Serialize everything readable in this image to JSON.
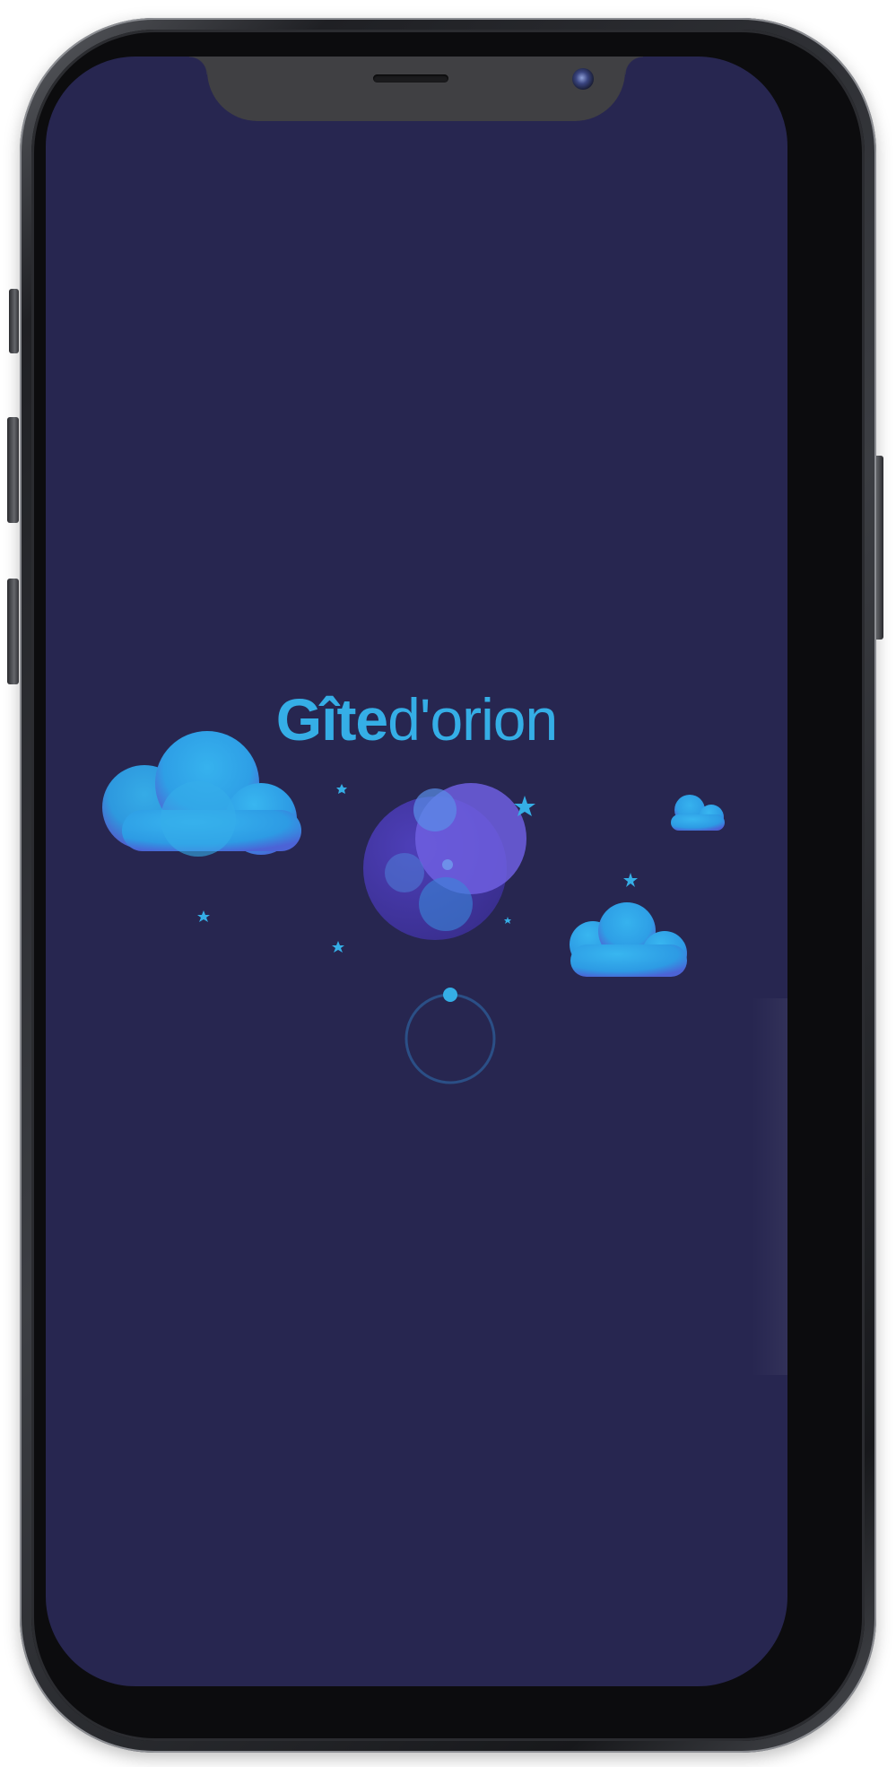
{
  "app": {
    "logo_bold": "Gîte",
    "logo_light": "d'orion",
    "background_color": "#272650",
    "accent_color": "#35aee6"
  },
  "loading": {
    "indicator": "circular-spinner"
  },
  "illustration": {
    "elements": [
      "cloud-large",
      "moon",
      "cloud-small",
      "cloud-medium",
      "stars"
    ]
  }
}
